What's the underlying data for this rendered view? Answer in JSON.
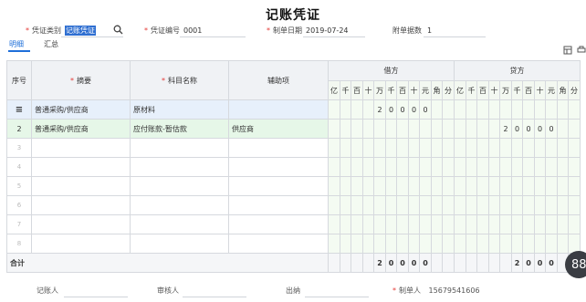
{
  "title": "记账凭证",
  "header": {
    "voucher_type_label": "凭证类别",
    "voucher_type_value": "记账凭证",
    "voucher_no_label": "凭证编号",
    "voucher_no_value": "0001",
    "date_label": "制单日期",
    "date_value": "2019-07-24",
    "attachments_label": "附单据数",
    "attachments_value": "1"
  },
  "tabs": [
    "明细",
    "汇总"
  ],
  "table": {
    "col_seq": "序号",
    "col_summary": "摘要",
    "col_account": "科目名称",
    "col_aux": "辅助项",
    "col_debit": "借方",
    "col_credit": "贷方",
    "digits": [
      "亿",
      "千",
      "百",
      "十",
      "万",
      "千",
      "百",
      "十",
      "元",
      "角",
      "分"
    ],
    "rows": [
      {
        "seq": "",
        "summary": "普通采购/供应商",
        "account": "原材料",
        "aux": "",
        "debit": "20000",
        "credit": ""
      },
      {
        "seq": "2",
        "summary": "普通采购/供应商",
        "account": "应付账款-暂估款",
        "aux": "供应商",
        "debit": "",
        "credit": "20000"
      }
    ],
    "empty_rows": [
      "3",
      "4",
      "5",
      "6",
      "7",
      "8"
    ],
    "total_label": "合计",
    "total_debit": "20000",
    "total_credit": "2000"
  },
  "footer": {
    "bookkeeper_label": "记账人",
    "reviewer_label": "审核人",
    "cashier_label": "出纳",
    "maker_label": "制单人",
    "maker_value": "15679541606"
  },
  "fab_text": "88"
}
